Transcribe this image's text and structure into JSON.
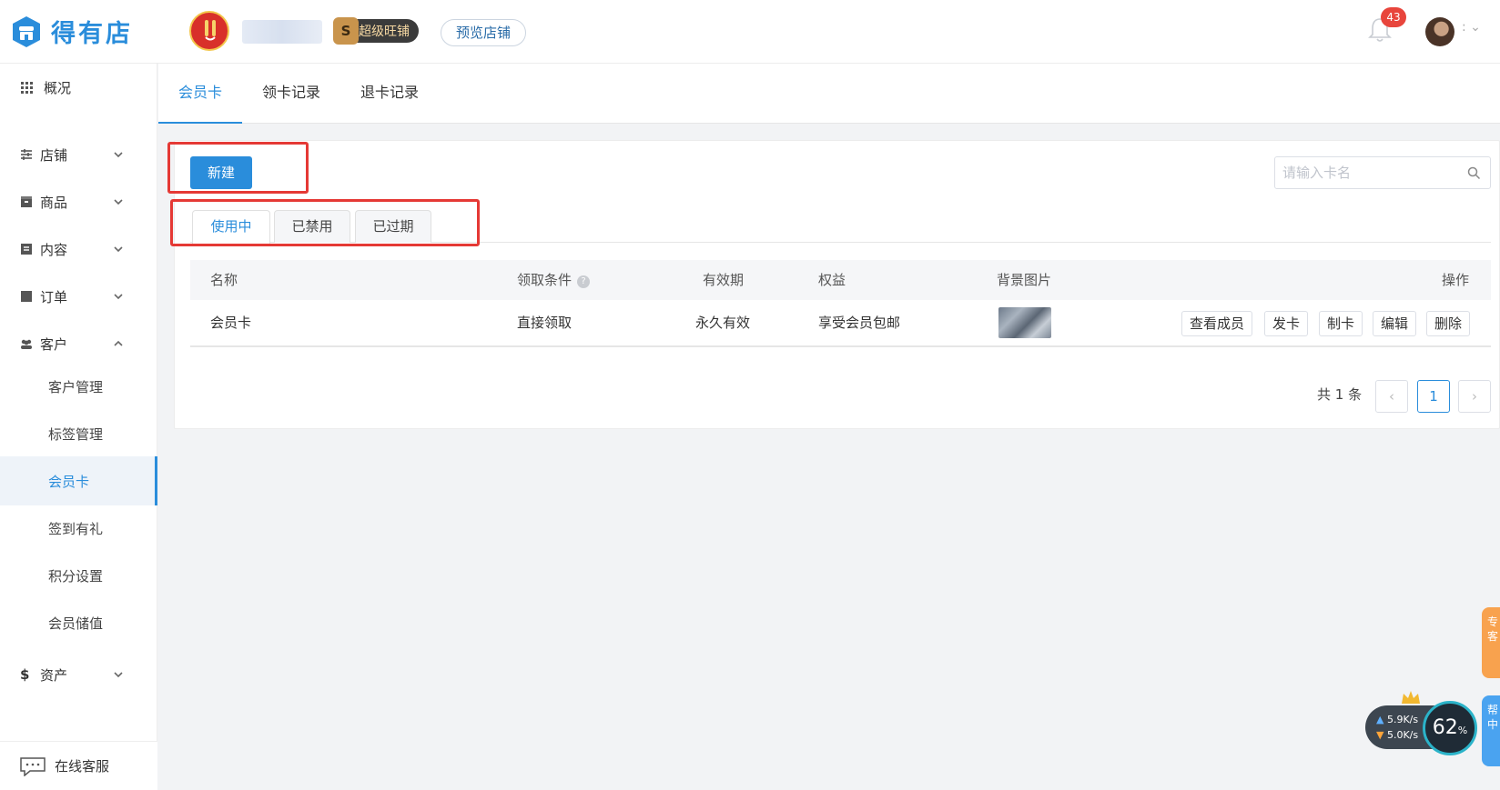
{
  "header": {
    "logo_text": "得有店",
    "vip_badge_letter": "S",
    "vip_badge_label": "超级旺铺",
    "preview_label": "预览店铺",
    "notification_count": "43"
  },
  "sidebar": {
    "overview": "概况",
    "store": "店铺",
    "goods": "商品",
    "content": "内容",
    "orders": "订单",
    "customers": "客户",
    "sub": [
      "客户管理",
      "标签管理",
      "会员卡",
      "签到有礼",
      "积分设置",
      "会员储值"
    ],
    "assets": "资产",
    "footer": "在线客服"
  },
  "page_tabs": [
    "会员卡",
    "领卡记录",
    "退卡记录"
  ],
  "toolbar": {
    "new_label": "新建",
    "search_placeholder": "请输入卡名"
  },
  "status_tabs": [
    "使用中",
    "已禁用",
    "已过期"
  ],
  "table": {
    "headers": {
      "name": "名称",
      "condition": "领取条件",
      "validity": "有效期",
      "benefit": "权益",
      "background": "背景图片",
      "actions": "操作"
    },
    "rows": [
      {
        "name": "会员卡",
        "condition": "直接领取",
        "validity": "永久有效",
        "benefit": "享受会员包邮",
        "actions": [
          "查看成员",
          "发卡",
          "制卡",
          "编辑",
          "删除"
        ]
      }
    ]
  },
  "pagination": {
    "total": "共 1 条",
    "current": "1",
    "prev": "‹",
    "next": "›"
  },
  "floating": {
    "orange_text": "专\n客",
    "blue_text": "帮\n中",
    "speed_up": "5.9",
    "speed_down": "5.0",
    "speed_unit": "K/s",
    "percent": "62",
    "percent_unit": "%"
  },
  "colors": {
    "accent": "#2a8ddb",
    "highlight_box": "#e53935",
    "badge": "#e8453c"
  }
}
